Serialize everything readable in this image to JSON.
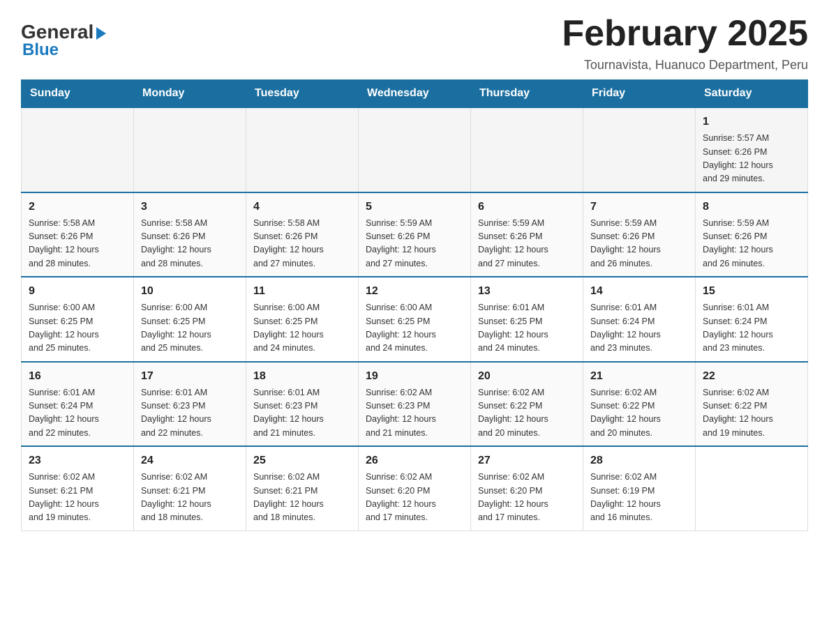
{
  "logo": {
    "text_general": "General",
    "text_blue": "Blue"
  },
  "title": "February 2025",
  "subtitle": "Tournavista, Huanuco Department, Peru",
  "weekdays": [
    "Sunday",
    "Monday",
    "Tuesday",
    "Wednesday",
    "Thursday",
    "Friday",
    "Saturday"
  ],
  "weeks": [
    [
      {
        "day": "",
        "info": ""
      },
      {
        "day": "",
        "info": ""
      },
      {
        "day": "",
        "info": ""
      },
      {
        "day": "",
        "info": ""
      },
      {
        "day": "",
        "info": ""
      },
      {
        "day": "",
        "info": ""
      },
      {
        "day": "1",
        "info": "Sunrise: 5:57 AM\nSunset: 6:26 PM\nDaylight: 12 hours\nand 29 minutes."
      }
    ],
    [
      {
        "day": "2",
        "info": "Sunrise: 5:58 AM\nSunset: 6:26 PM\nDaylight: 12 hours\nand 28 minutes."
      },
      {
        "day": "3",
        "info": "Sunrise: 5:58 AM\nSunset: 6:26 PM\nDaylight: 12 hours\nand 28 minutes."
      },
      {
        "day": "4",
        "info": "Sunrise: 5:58 AM\nSunset: 6:26 PM\nDaylight: 12 hours\nand 27 minutes."
      },
      {
        "day": "5",
        "info": "Sunrise: 5:59 AM\nSunset: 6:26 PM\nDaylight: 12 hours\nand 27 minutes."
      },
      {
        "day": "6",
        "info": "Sunrise: 5:59 AM\nSunset: 6:26 PM\nDaylight: 12 hours\nand 27 minutes."
      },
      {
        "day": "7",
        "info": "Sunrise: 5:59 AM\nSunset: 6:26 PM\nDaylight: 12 hours\nand 26 minutes."
      },
      {
        "day": "8",
        "info": "Sunrise: 5:59 AM\nSunset: 6:26 PM\nDaylight: 12 hours\nand 26 minutes."
      }
    ],
    [
      {
        "day": "9",
        "info": "Sunrise: 6:00 AM\nSunset: 6:25 PM\nDaylight: 12 hours\nand 25 minutes."
      },
      {
        "day": "10",
        "info": "Sunrise: 6:00 AM\nSunset: 6:25 PM\nDaylight: 12 hours\nand 25 minutes."
      },
      {
        "day": "11",
        "info": "Sunrise: 6:00 AM\nSunset: 6:25 PM\nDaylight: 12 hours\nand 24 minutes."
      },
      {
        "day": "12",
        "info": "Sunrise: 6:00 AM\nSunset: 6:25 PM\nDaylight: 12 hours\nand 24 minutes."
      },
      {
        "day": "13",
        "info": "Sunrise: 6:01 AM\nSunset: 6:25 PM\nDaylight: 12 hours\nand 24 minutes."
      },
      {
        "day": "14",
        "info": "Sunrise: 6:01 AM\nSunset: 6:24 PM\nDaylight: 12 hours\nand 23 minutes."
      },
      {
        "day": "15",
        "info": "Sunrise: 6:01 AM\nSunset: 6:24 PM\nDaylight: 12 hours\nand 23 minutes."
      }
    ],
    [
      {
        "day": "16",
        "info": "Sunrise: 6:01 AM\nSunset: 6:24 PM\nDaylight: 12 hours\nand 22 minutes."
      },
      {
        "day": "17",
        "info": "Sunrise: 6:01 AM\nSunset: 6:23 PM\nDaylight: 12 hours\nand 22 minutes."
      },
      {
        "day": "18",
        "info": "Sunrise: 6:01 AM\nSunset: 6:23 PM\nDaylight: 12 hours\nand 21 minutes."
      },
      {
        "day": "19",
        "info": "Sunrise: 6:02 AM\nSunset: 6:23 PM\nDaylight: 12 hours\nand 21 minutes."
      },
      {
        "day": "20",
        "info": "Sunrise: 6:02 AM\nSunset: 6:22 PM\nDaylight: 12 hours\nand 20 minutes."
      },
      {
        "day": "21",
        "info": "Sunrise: 6:02 AM\nSunset: 6:22 PM\nDaylight: 12 hours\nand 20 minutes."
      },
      {
        "day": "22",
        "info": "Sunrise: 6:02 AM\nSunset: 6:22 PM\nDaylight: 12 hours\nand 19 minutes."
      }
    ],
    [
      {
        "day": "23",
        "info": "Sunrise: 6:02 AM\nSunset: 6:21 PM\nDaylight: 12 hours\nand 19 minutes."
      },
      {
        "day": "24",
        "info": "Sunrise: 6:02 AM\nSunset: 6:21 PM\nDaylight: 12 hours\nand 18 minutes."
      },
      {
        "day": "25",
        "info": "Sunrise: 6:02 AM\nSunset: 6:21 PM\nDaylight: 12 hours\nand 18 minutes."
      },
      {
        "day": "26",
        "info": "Sunrise: 6:02 AM\nSunset: 6:20 PM\nDaylight: 12 hours\nand 17 minutes."
      },
      {
        "day": "27",
        "info": "Sunrise: 6:02 AM\nSunset: 6:20 PM\nDaylight: 12 hours\nand 17 minutes."
      },
      {
        "day": "28",
        "info": "Sunrise: 6:02 AM\nSunset: 6:19 PM\nDaylight: 12 hours\nand 16 minutes."
      },
      {
        "day": "",
        "info": ""
      }
    ]
  ]
}
